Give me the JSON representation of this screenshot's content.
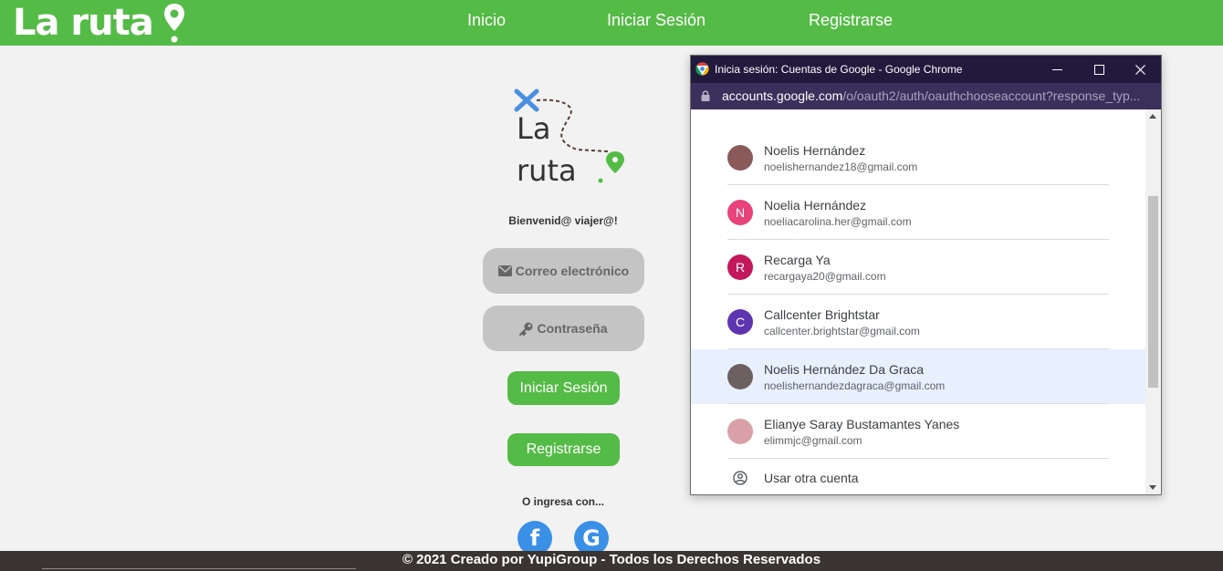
{
  "nav": {
    "brand": "La ruta",
    "links": [
      "Inicio",
      "Iniciar Sesión",
      "Registrarse"
    ],
    "color": "#55bb47"
  },
  "login": {
    "logo_line1": "La",
    "logo_line2": "ruta",
    "welcome": "Bienvenid@ viajer@!",
    "email_placeholder": "Correo electrónico",
    "password_placeholder": "Contraseña",
    "login_button": "Iniciar Sesión",
    "register_button": "Registrarse",
    "social_prompt": "O ingresa con...",
    "social": [
      {
        "icon": "facebook-icon",
        "glyph": "f"
      },
      {
        "icon": "google-icon",
        "glyph": "G"
      }
    ]
  },
  "footer": {
    "text": "© 2021 Creado por YupiGroup - Todos los Derechos Reservados"
  },
  "popup": {
    "window_title": "Inicia sesión: Cuentas de Google - Google Chrome",
    "url_host": "accounts.google.com",
    "url_path": "/o/oauth2/auth/oauthchooseaccount?response_typ...",
    "accounts": [
      {
        "name": "Noelis Hernández",
        "email": "noelishernandez18@gmail.com",
        "initial": "",
        "avatar_color": "#8a5a5a"
      },
      {
        "name": "Noelia Hernández",
        "email": "noeliacarolina.her@gmail.com",
        "initial": "N",
        "avatar_color": "#e8437a"
      },
      {
        "name": "Recarga Ya",
        "email": "recargaya20@gmail.com",
        "initial": "R",
        "avatar_color": "#c2185b"
      },
      {
        "name": "Callcenter Brightstar",
        "email": "callcenter.brightstar@gmail.com",
        "initial": "C",
        "avatar_color": "#5e35b1"
      },
      {
        "name": "Noelis Hernández Da Graca",
        "email": "noelishernandezdagraca@gmail.com",
        "initial": "",
        "avatar_color": "#6d6060"
      },
      {
        "name": "Elianye Saray Bustamantes Yanes",
        "email": "elimmjc@gmail.com",
        "initial": "",
        "avatar_color": "#d9a0a8"
      }
    ],
    "highlighted_index": 4,
    "use_other": "Usar otra cuenta"
  }
}
